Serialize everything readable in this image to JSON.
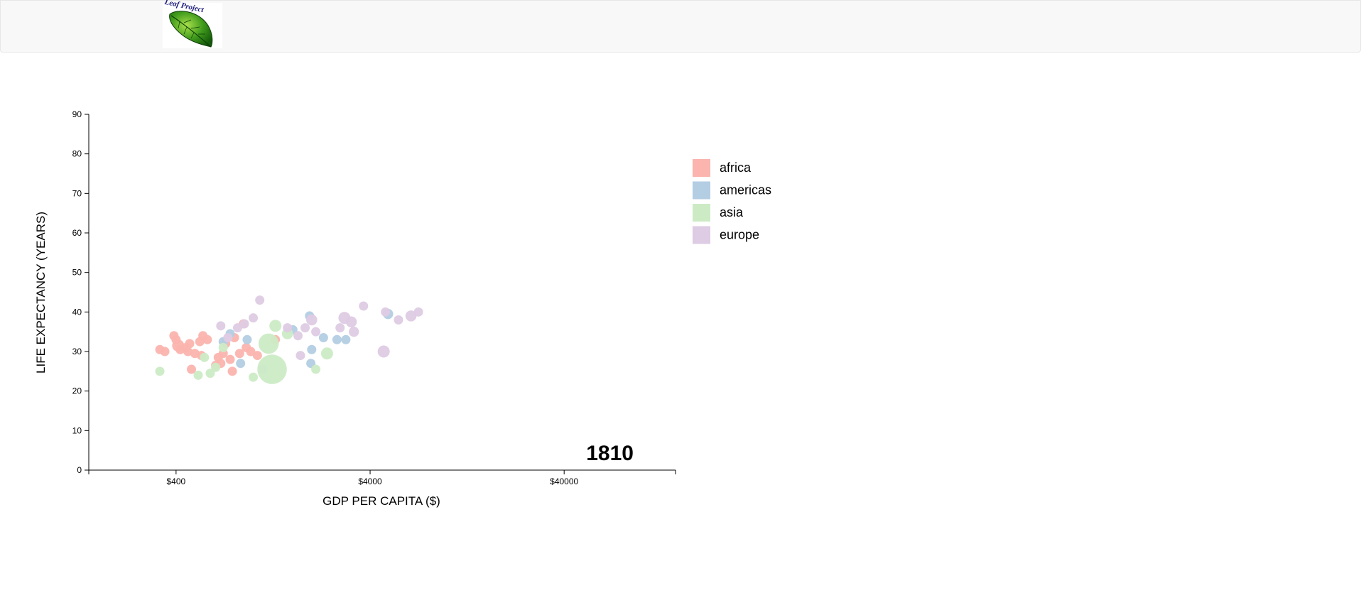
{
  "header": {
    "logo_icon": "leaf-logo-icon",
    "logo_text": "Leaf Project"
  },
  "chart_data": {
    "type": "scatter",
    "xlabel": "GDP PER CAPITA ($)",
    "ylabel": "LIFE EXPECTANCY (YEARS)",
    "x_scale": "log",
    "xlim": [
      142,
      150000
    ],
    "ylim": [
      0,
      90
    ],
    "x_ticks": [
      {
        "value": 400,
        "label": "$400"
      },
      {
        "value": 4000,
        "label": "$4000"
      },
      {
        "value": 40000,
        "label": "$40000"
      }
    ],
    "y_ticks": [
      {
        "value": 0,
        "label": "0"
      },
      {
        "value": 10,
        "label": "10"
      },
      {
        "value": 20,
        "label": "20"
      },
      {
        "value": 30,
        "label": "30"
      },
      {
        "value": 40,
        "label": "40"
      },
      {
        "value": 50,
        "label": "50"
      },
      {
        "value": 60,
        "label": "60"
      },
      {
        "value": 70,
        "label": "70"
      },
      {
        "value": 80,
        "label": "80"
      },
      {
        "value": 90,
        "label": "90"
      }
    ],
    "year": "1810",
    "grid": false,
    "legend_position": "right",
    "legend": [
      {
        "name": "africa",
        "color": "#fbb4ae"
      },
      {
        "name": "americas",
        "color": "#b3cde3"
      },
      {
        "name": "asia",
        "color": "#ccebc5"
      },
      {
        "name": "europe",
        "color": "#decbe4"
      }
    ],
    "points": [
      {
        "c": "africa",
        "x": 330,
        "y": 30.5,
        "s": 1
      },
      {
        "c": "africa",
        "x": 350,
        "y": 30.0,
        "s": 1
      },
      {
        "c": "africa",
        "x": 390,
        "y": 34.0,
        "s": 1
      },
      {
        "c": "africa",
        "x": 400,
        "y": 33.0,
        "s": 1
      },
      {
        "c": "africa",
        "x": 410,
        "y": 31.5,
        "s": 1.3
      },
      {
        "c": "africa",
        "x": 420,
        "y": 30.5,
        "s": 1
      },
      {
        "c": "africa",
        "x": 450,
        "y": 31.0,
        "s": 1
      },
      {
        "c": "africa",
        "x": 460,
        "y": 30.0,
        "s": 1
      },
      {
        "c": "africa",
        "x": 470,
        "y": 32.0,
        "s": 1
      },
      {
        "c": "africa",
        "x": 480,
        "y": 25.5,
        "s": 1
      },
      {
        "c": "africa",
        "x": 500,
        "y": 29.5,
        "s": 1
      },
      {
        "c": "africa",
        "x": 530,
        "y": 32.5,
        "s": 1
      },
      {
        "c": "africa",
        "x": 540,
        "y": 29.0,
        "s": 1
      },
      {
        "c": "africa",
        "x": 550,
        "y": 34.0,
        "s": 1
      },
      {
        "c": "africa",
        "x": 580,
        "y": 33.0,
        "s": 1
      },
      {
        "c": "africa",
        "x": 640,
        "y": 26.5,
        "s": 1
      },
      {
        "c": "africa",
        "x": 660,
        "y": 28.5,
        "s": 1
      },
      {
        "c": "africa",
        "x": 680,
        "y": 27.0,
        "s": 1
      },
      {
        "c": "africa",
        "x": 700,
        "y": 29.5,
        "s": 1
      },
      {
        "c": "africa",
        "x": 720,
        "y": 32.0,
        "s": 1
      },
      {
        "c": "africa",
        "x": 760,
        "y": 28.0,
        "s": 1
      },
      {
        "c": "africa",
        "x": 780,
        "y": 25.0,
        "s": 1
      },
      {
        "c": "africa",
        "x": 800,
        "y": 33.5,
        "s": 1
      },
      {
        "c": "africa",
        "x": 850,
        "y": 29.5,
        "s": 1
      },
      {
        "c": "africa",
        "x": 890,
        "y": 37.0,
        "s": 1
      },
      {
        "c": "africa",
        "x": 920,
        "y": 31.0,
        "s": 1
      },
      {
        "c": "africa",
        "x": 970,
        "y": 30.0,
        "s": 1
      },
      {
        "c": "africa",
        "x": 1050,
        "y": 29.0,
        "s": 1
      },
      {
        "c": "africa",
        "x": 1300,
        "y": 33.0,
        "s": 1
      },
      {
        "c": "americas",
        "x": 700,
        "y": 32.5,
        "s": 1
      },
      {
        "c": "americas",
        "x": 760,
        "y": 34.5,
        "s": 1
      },
      {
        "c": "americas",
        "x": 860,
        "y": 27.0,
        "s": 1
      },
      {
        "c": "americas",
        "x": 930,
        "y": 33.0,
        "s": 1
      },
      {
        "c": "americas",
        "x": 1120,
        "y": 25.5,
        "s": 1
      },
      {
        "c": "americas",
        "x": 1600,
        "y": 35.5,
        "s": 1
      },
      {
        "c": "americas",
        "x": 1950,
        "y": 39.0,
        "s": 1
      },
      {
        "c": "americas",
        "x": 2000,
        "y": 30.5,
        "s": 1
      },
      {
        "c": "americas",
        "x": 1980,
        "y": 27.0,
        "s": 1
      },
      {
        "c": "americas",
        "x": 2300,
        "y": 33.5,
        "s": 1
      },
      {
        "c": "americas",
        "x": 2700,
        "y": 33.0,
        "s": 1
      },
      {
        "c": "americas",
        "x": 3000,
        "y": 33.0,
        "s": 1
      },
      {
        "c": "americas",
        "x": 4950,
        "y": 39.5,
        "s": 1.1
      },
      {
        "c": "asia",
        "x": 330,
        "y": 25.0,
        "s": 1
      },
      {
        "c": "asia",
        "x": 520,
        "y": 24.0,
        "s": 1
      },
      {
        "c": "asia",
        "x": 560,
        "y": 28.5,
        "s": 1
      },
      {
        "c": "asia",
        "x": 600,
        "y": 24.5,
        "s": 1
      },
      {
        "c": "asia",
        "x": 640,
        "y": 26.0,
        "s": 1
      },
      {
        "c": "asia",
        "x": 700,
        "y": 31.0,
        "s": 1
      },
      {
        "c": "asia",
        "x": 1000,
        "y": 23.5,
        "s": 1
      },
      {
        "c": "asia",
        "x": 1200,
        "y": 32.0,
        "s": 2.2
      },
      {
        "c": "asia",
        "x": 1250,
        "y": 25.5,
        "s": 3.2
      },
      {
        "c": "asia",
        "x": 1300,
        "y": 36.5,
        "s": 1.3
      },
      {
        "c": "asia",
        "x": 1500,
        "y": 34.5,
        "s": 1.2
      },
      {
        "c": "asia",
        "x": 2100,
        "y": 25.5,
        "s": 1
      },
      {
        "c": "asia",
        "x": 2400,
        "y": 29.5,
        "s": 1.3
      },
      {
        "c": "europe",
        "x": 680,
        "y": 36.5,
        "s": 1
      },
      {
        "c": "europe",
        "x": 740,
        "y": 33.5,
        "s": 1
      },
      {
        "c": "europe",
        "x": 830,
        "y": 36.0,
        "s": 1
      },
      {
        "c": "europe",
        "x": 900,
        "y": 37.0,
        "s": 1
      },
      {
        "c": "europe",
        "x": 1000,
        "y": 38.5,
        "s": 1
      },
      {
        "c": "europe",
        "x": 1080,
        "y": 43.0,
        "s": 1
      },
      {
        "c": "europe",
        "x": 1500,
        "y": 36.0,
        "s": 1
      },
      {
        "c": "europe",
        "x": 1700,
        "y": 34.0,
        "s": 1
      },
      {
        "c": "europe",
        "x": 1750,
        "y": 29.0,
        "s": 1
      },
      {
        "c": "europe",
        "x": 1850,
        "y": 36.0,
        "s": 1
      },
      {
        "c": "europe",
        "x": 2000,
        "y": 38.0,
        "s": 1.2
      },
      {
        "c": "europe",
        "x": 2100,
        "y": 35.0,
        "s": 1
      },
      {
        "c": "europe",
        "x": 2800,
        "y": 36.0,
        "s": 1
      },
      {
        "c": "europe",
        "x": 2950,
        "y": 38.5,
        "s": 1.3
      },
      {
        "c": "europe",
        "x": 3200,
        "y": 37.5,
        "s": 1.2
      },
      {
        "c": "europe",
        "x": 3300,
        "y": 35.0,
        "s": 1.1
      },
      {
        "c": "europe",
        "x": 3700,
        "y": 41.5,
        "s": 1
      },
      {
        "c": "europe",
        "x": 4700,
        "y": 30.0,
        "s": 1.3
      },
      {
        "c": "europe",
        "x": 4800,
        "y": 40.0,
        "s": 1
      },
      {
        "c": "europe",
        "x": 5600,
        "y": 38.0,
        "s": 1
      },
      {
        "c": "europe",
        "x": 6500,
        "y": 39.0,
        "s": 1.2
      },
      {
        "c": "europe",
        "x": 7100,
        "y": 40.0,
        "s": 1
      }
    ]
  }
}
